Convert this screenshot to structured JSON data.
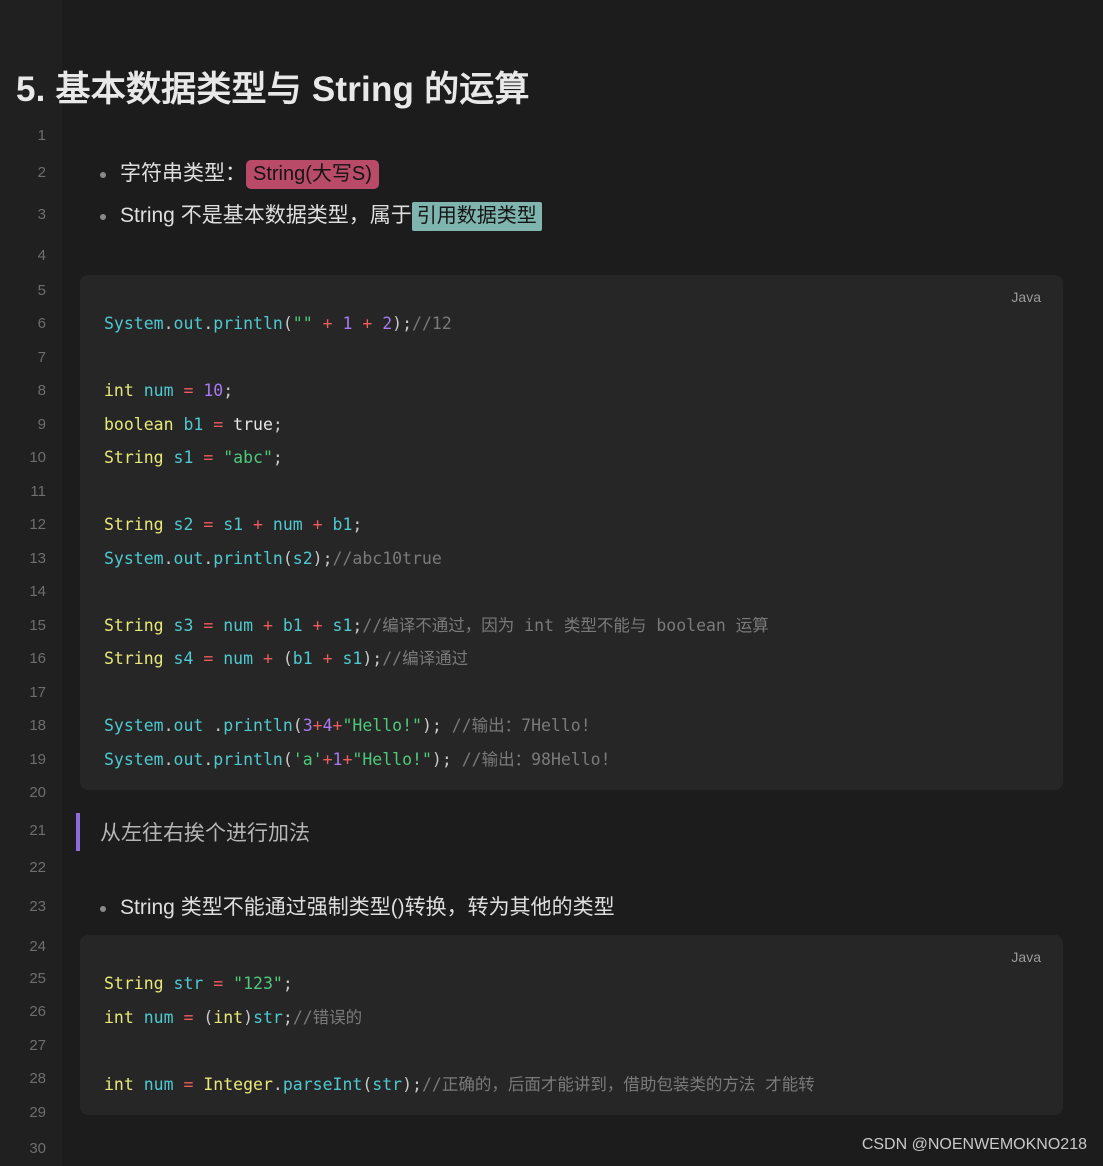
{
  "page": {
    "title": "5. 基本数据类型与 String 的运算",
    "background": "#1c1c1c",
    "gutter_background": "#202020",
    "code_background": "#262626"
  },
  "gutter": {
    "line_numbers": [
      "1",
      "2",
      "3",
      "4",
      "5",
      "6",
      "7",
      "8",
      "9",
      "10",
      "11",
      "12",
      "13",
      "14",
      "15",
      "16",
      "17",
      "18",
      "19",
      "20",
      "21",
      "22",
      "23",
      "24",
      "25",
      "26",
      "27",
      "28",
      "29",
      "30"
    ]
  },
  "bullets_top": [
    {
      "prefix": "字符串类型：",
      "highlight": "String(大写S)",
      "highlight_color": "#b94a68",
      "suffix": ""
    },
    {
      "prefix": "String 不是基本数据类型，属于",
      "highlight": "引用数据类型",
      "highlight_color": "#7fb5ae",
      "suffix": ""
    }
  ],
  "code_block_1": {
    "lang_label": "Java",
    "lines": [
      [
        {
          "t": "System",
          "c": "id"
        },
        {
          "t": ".",
          "c": "pn"
        },
        {
          "t": "out",
          "c": "id"
        },
        {
          "t": ".",
          "c": "pn"
        },
        {
          "t": "println",
          "c": "fn"
        },
        {
          "t": "(",
          "c": "pn"
        },
        {
          "t": "\"\"",
          "c": "str"
        },
        {
          "t": " ",
          "c": "pn"
        },
        {
          "t": "+",
          "c": "op"
        },
        {
          "t": " ",
          "c": "pn"
        },
        {
          "t": "1",
          "c": "num"
        },
        {
          "t": " ",
          "c": "pn"
        },
        {
          "t": "+",
          "c": "op"
        },
        {
          "t": " ",
          "c": "pn"
        },
        {
          "t": "2",
          "c": "num"
        },
        {
          "t": ");",
          "c": "pn"
        },
        {
          "t": "//12",
          "c": "cmt"
        }
      ],
      [],
      [
        {
          "t": "int",
          "c": "kw"
        },
        {
          "t": " ",
          "c": "pn"
        },
        {
          "t": "num",
          "c": "id"
        },
        {
          "t": " ",
          "c": "pn"
        },
        {
          "t": "=",
          "c": "op"
        },
        {
          "t": " ",
          "c": "pn"
        },
        {
          "t": "10",
          "c": "num"
        },
        {
          "t": ";",
          "c": "pn"
        }
      ],
      [
        {
          "t": "boolean",
          "c": "kw"
        },
        {
          "t": " ",
          "c": "pn"
        },
        {
          "t": "b1",
          "c": "id"
        },
        {
          "t": " ",
          "c": "pn"
        },
        {
          "t": "=",
          "c": "op"
        },
        {
          "t": " ",
          "c": "pn"
        },
        {
          "t": "true",
          "c": "lit"
        },
        {
          "t": ";",
          "c": "pn"
        }
      ],
      [
        {
          "t": "String",
          "c": "kw"
        },
        {
          "t": " ",
          "c": "pn"
        },
        {
          "t": "s1",
          "c": "id"
        },
        {
          "t": " ",
          "c": "pn"
        },
        {
          "t": "=",
          "c": "op"
        },
        {
          "t": " ",
          "c": "pn"
        },
        {
          "t": "\"abc\"",
          "c": "str"
        },
        {
          "t": ";",
          "c": "pn"
        }
      ],
      [],
      [
        {
          "t": "String",
          "c": "kw"
        },
        {
          "t": " ",
          "c": "pn"
        },
        {
          "t": "s2",
          "c": "id"
        },
        {
          "t": " ",
          "c": "pn"
        },
        {
          "t": "=",
          "c": "op"
        },
        {
          "t": " ",
          "c": "pn"
        },
        {
          "t": "s1",
          "c": "id"
        },
        {
          "t": " ",
          "c": "pn"
        },
        {
          "t": "+",
          "c": "op"
        },
        {
          "t": " ",
          "c": "pn"
        },
        {
          "t": "num",
          "c": "id"
        },
        {
          "t": " ",
          "c": "pn"
        },
        {
          "t": "+",
          "c": "op"
        },
        {
          "t": " ",
          "c": "pn"
        },
        {
          "t": "b1",
          "c": "id"
        },
        {
          "t": ";",
          "c": "pn"
        }
      ],
      [
        {
          "t": "System",
          "c": "id"
        },
        {
          "t": ".",
          "c": "pn"
        },
        {
          "t": "out",
          "c": "id"
        },
        {
          "t": ".",
          "c": "pn"
        },
        {
          "t": "println",
          "c": "fn"
        },
        {
          "t": "(",
          "c": "pn"
        },
        {
          "t": "s2",
          "c": "id"
        },
        {
          "t": ");",
          "c": "pn"
        },
        {
          "t": "//abc10true",
          "c": "cmt"
        }
      ],
      [],
      [
        {
          "t": "String",
          "c": "kw"
        },
        {
          "t": " ",
          "c": "pn"
        },
        {
          "t": "s3",
          "c": "id"
        },
        {
          "t": " ",
          "c": "pn"
        },
        {
          "t": "=",
          "c": "op"
        },
        {
          "t": " ",
          "c": "pn"
        },
        {
          "t": "num",
          "c": "id"
        },
        {
          "t": " ",
          "c": "pn"
        },
        {
          "t": "+",
          "c": "op"
        },
        {
          "t": " ",
          "c": "pn"
        },
        {
          "t": "b1",
          "c": "id"
        },
        {
          "t": " ",
          "c": "pn"
        },
        {
          "t": "+",
          "c": "op"
        },
        {
          "t": " ",
          "c": "pn"
        },
        {
          "t": "s1",
          "c": "id"
        },
        {
          "t": ";",
          "c": "pn"
        },
        {
          "t": "//编译不通过，因为 int 类型不能与 boolean 运算",
          "c": "cmt"
        }
      ],
      [
        {
          "t": "String",
          "c": "kw"
        },
        {
          "t": " ",
          "c": "pn"
        },
        {
          "t": "s4",
          "c": "id"
        },
        {
          "t": " ",
          "c": "pn"
        },
        {
          "t": "=",
          "c": "op"
        },
        {
          "t": " ",
          "c": "pn"
        },
        {
          "t": "num",
          "c": "id"
        },
        {
          "t": " ",
          "c": "pn"
        },
        {
          "t": "+",
          "c": "op"
        },
        {
          "t": " ",
          "c": "pn"
        },
        {
          "t": "(",
          "c": "pn"
        },
        {
          "t": "b1",
          "c": "id"
        },
        {
          "t": " ",
          "c": "pn"
        },
        {
          "t": "+",
          "c": "op"
        },
        {
          "t": " ",
          "c": "pn"
        },
        {
          "t": "s1",
          "c": "id"
        },
        {
          "t": ");",
          "c": "pn"
        },
        {
          "t": "//编译通过",
          "c": "cmt"
        }
      ],
      [],
      [
        {
          "t": "System",
          "c": "id"
        },
        {
          "t": ".",
          "c": "pn"
        },
        {
          "t": "out",
          "c": "id"
        },
        {
          "t": " .",
          "c": "pn"
        },
        {
          "t": "println",
          "c": "fn"
        },
        {
          "t": "(",
          "c": "pn"
        },
        {
          "t": "3",
          "c": "num"
        },
        {
          "t": "+",
          "c": "op"
        },
        {
          "t": "4",
          "c": "num"
        },
        {
          "t": "+",
          "c": "op"
        },
        {
          "t": "\"Hello!\"",
          "c": "str"
        },
        {
          "t": "); ",
          "c": "pn"
        },
        {
          "t": "//输出：7Hello!",
          "c": "cmt"
        }
      ],
      [
        {
          "t": "System",
          "c": "id"
        },
        {
          "t": ".",
          "c": "pn"
        },
        {
          "t": "out",
          "c": "id"
        },
        {
          "t": ".",
          "c": "pn"
        },
        {
          "t": "println",
          "c": "fn"
        },
        {
          "t": "(",
          "c": "pn"
        },
        {
          "t": "'a'",
          "c": "str"
        },
        {
          "t": "+",
          "c": "op"
        },
        {
          "t": "1",
          "c": "num"
        },
        {
          "t": "+",
          "c": "op"
        },
        {
          "t": "\"Hello!\"",
          "c": "str"
        },
        {
          "t": "); ",
          "c": "pn"
        },
        {
          "t": "//输出：98Hello!",
          "c": "cmt"
        }
      ]
    ]
  },
  "quote": {
    "text": "从左往右挨个进行加法",
    "accent_color": "#8c6bdc"
  },
  "bullets_bottom": [
    {
      "prefix": "String 类型不能通过强制类型()转换，转为其他的类型",
      "highlight": "",
      "suffix": ""
    }
  ],
  "code_block_2": {
    "lang_label": "Java",
    "lines": [
      [
        {
          "t": "String",
          "c": "kw"
        },
        {
          "t": " ",
          "c": "pn"
        },
        {
          "t": "str",
          "c": "id"
        },
        {
          "t": " ",
          "c": "pn"
        },
        {
          "t": "=",
          "c": "op"
        },
        {
          "t": " ",
          "c": "pn"
        },
        {
          "t": "\"123\"",
          "c": "str"
        },
        {
          "t": ";",
          "c": "pn"
        }
      ],
      [
        {
          "t": "int",
          "c": "kw"
        },
        {
          "t": " ",
          "c": "pn"
        },
        {
          "t": "num",
          "c": "id"
        },
        {
          "t": " ",
          "c": "pn"
        },
        {
          "t": "=",
          "c": "op"
        },
        {
          "t": " ",
          "c": "pn"
        },
        {
          "t": "(",
          "c": "pn"
        },
        {
          "t": "int",
          "c": "kw"
        },
        {
          "t": ")",
          "c": "pn"
        },
        {
          "t": "str",
          "c": "id"
        },
        {
          "t": ";",
          "c": "pn"
        },
        {
          "t": "//错误的",
          "c": "cmt"
        }
      ],
      [],
      [
        {
          "t": "int",
          "c": "kw"
        },
        {
          "t": " ",
          "c": "pn"
        },
        {
          "t": "num",
          "c": "id"
        },
        {
          "t": " ",
          "c": "pn"
        },
        {
          "t": "=",
          "c": "op"
        },
        {
          "t": " ",
          "c": "pn"
        },
        {
          "t": "Integer",
          "c": "kw"
        },
        {
          "t": ".",
          "c": "pn"
        },
        {
          "t": "parseInt",
          "c": "fn"
        },
        {
          "t": "(",
          "c": "pn"
        },
        {
          "t": "str",
          "c": "id"
        },
        {
          "t": ");",
          "c": "pn"
        },
        {
          "t": "//正确的，后面才能讲到，借助包装类的方法 才能转",
          "c": "cmt"
        }
      ]
    ]
  },
  "watermark": {
    "text": "CSDN @NOENWEMOKNO218"
  }
}
